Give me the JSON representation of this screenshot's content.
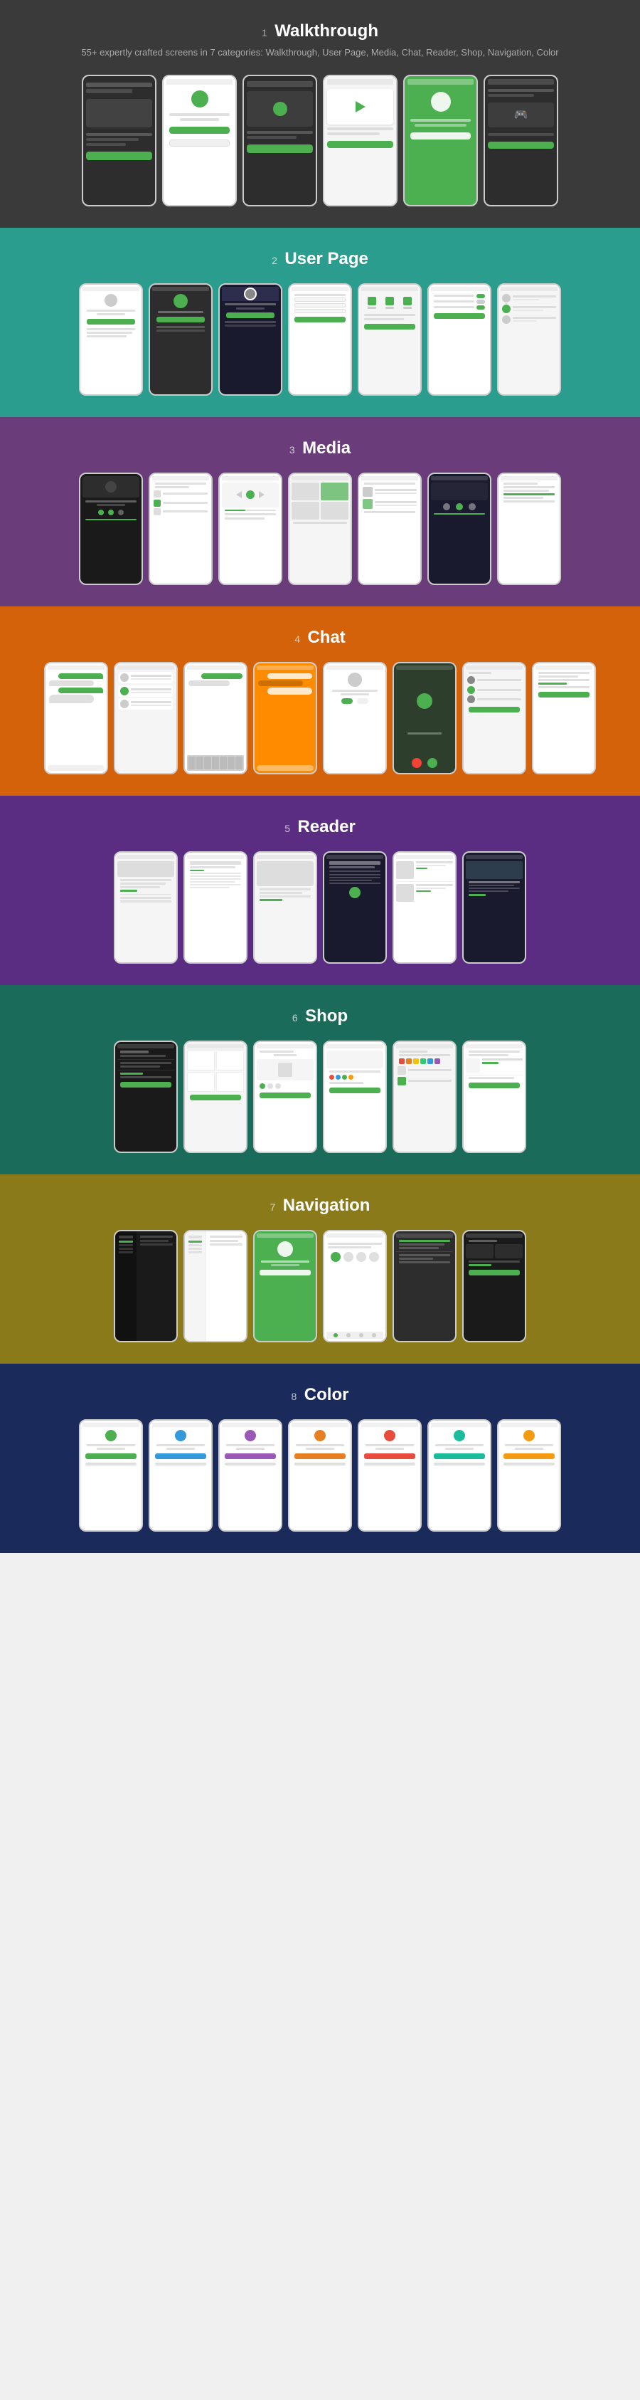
{
  "sections": [
    {
      "id": "walkthrough",
      "number": "1",
      "title": "Walkthrough",
      "subtitle": "55+ expertly crafted screens in 7 categories:\nWalkthrough, User Page, Media, Chat, Reader,\nShop, Navigation, Color",
      "bg_color": "#3a3a3a",
      "text_color": "white",
      "phones_count": 6
    },
    {
      "id": "user-page",
      "number": "2",
      "title": "User Page",
      "subtitle": "",
      "bg_color": "#2a9d8f",
      "text_color": "white",
      "phones_count": 7
    },
    {
      "id": "media",
      "number": "3",
      "title": "Media",
      "subtitle": "",
      "bg_color": "#6a3d7a",
      "text_color": "white",
      "phones_count": 7
    },
    {
      "id": "chat",
      "number": "4",
      "title": "Chat",
      "subtitle": "",
      "bg_color": "#d4620a",
      "text_color": "white",
      "phones_count": 8
    },
    {
      "id": "reader",
      "number": "5",
      "title": "Reader",
      "subtitle": "",
      "bg_color": "#5a2d82",
      "text_color": "white",
      "phones_count": 6
    },
    {
      "id": "shop",
      "number": "6",
      "title": "Shop",
      "subtitle": "",
      "bg_color": "#1a6b5a",
      "text_color": "white",
      "phones_count": 6
    },
    {
      "id": "navigation",
      "number": "7",
      "title": "Navigation",
      "subtitle": "",
      "bg_color": "#8a7a1a",
      "text_color": "white",
      "phones_count": 6
    },
    {
      "id": "color",
      "number": "8",
      "title": "Color",
      "subtitle": "",
      "bg_color": "#1a2a5a",
      "text_color": "white",
      "phones_count": 7
    }
  ],
  "labels": {
    "section_number_prefix": ""
  }
}
